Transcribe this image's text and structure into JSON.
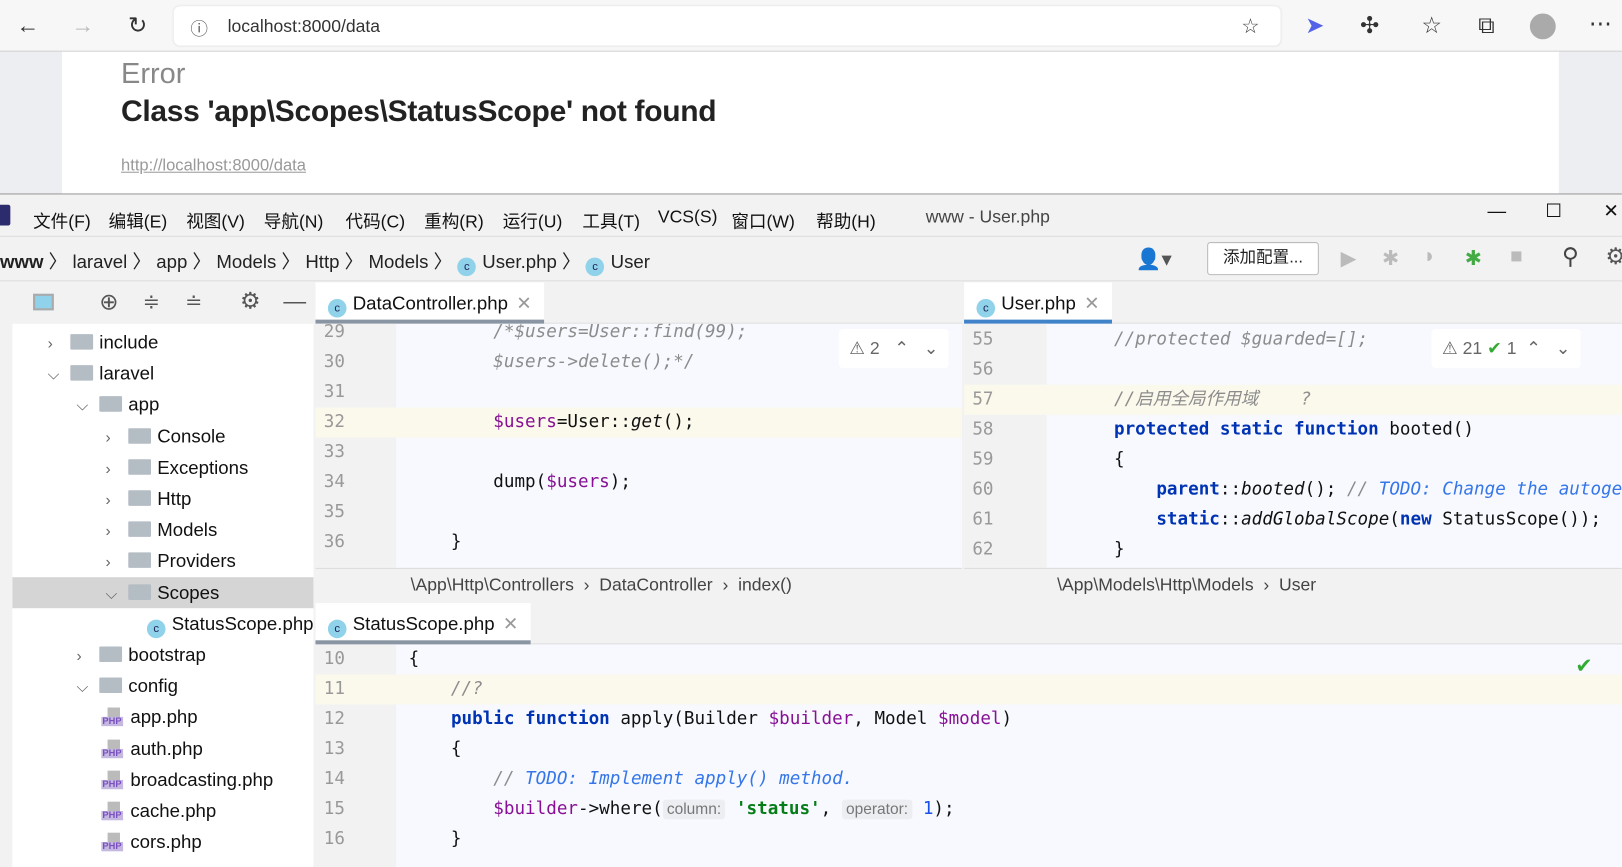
{
  "browser": {
    "url": "localhost:8000/data"
  },
  "page": {
    "error_label": "Error",
    "message": "Class 'app\\Scopes\\StatusScope' not found",
    "link": "http://localhost:8000/data"
  },
  "ide": {
    "menu": [
      "文件(F)",
      "编辑(E)",
      "视图(V)",
      "导航(N)",
      "代码(C)",
      "重构(R)",
      "运行(U)",
      "工具(T)",
      "VCS(S)",
      "窗口(W)",
      "帮助(H)"
    ],
    "window_title": "www - User.php",
    "breadcrumb": [
      "www",
      "laravel",
      "app",
      "Models",
      "Http",
      "Models",
      "User.php",
      "User"
    ],
    "add_config": "添加配置...",
    "tree": [
      {
        "label": "include",
        "depth": 0,
        "type": "folder",
        "expanded": false
      },
      {
        "label": "laravel",
        "depth": 0,
        "type": "folder",
        "expanded": true
      },
      {
        "label": "app",
        "depth": 1,
        "type": "folder",
        "expanded": true
      },
      {
        "label": "Console",
        "depth": 2,
        "type": "folder",
        "expanded": false
      },
      {
        "label": "Exceptions",
        "depth": 2,
        "type": "folder",
        "expanded": false
      },
      {
        "label": "Http",
        "depth": 2,
        "type": "folder",
        "expanded": false
      },
      {
        "label": "Models",
        "depth": 2,
        "type": "folder",
        "expanded": false
      },
      {
        "label": "Providers",
        "depth": 2,
        "type": "folder",
        "expanded": false
      },
      {
        "label": "Scopes",
        "depth": 2,
        "type": "folder",
        "expanded": true,
        "selected": true
      },
      {
        "label": "StatusScope.php",
        "depth": 3,
        "type": "class"
      },
      {
        "label": "bootstrap",
        "depth": 1,
        "type": "folder",
        "expanded": false
      },
      {
        "label": "config",
        "depth": 1,
        "type": "folder",
        "expanded": true
      },
      {
        "label": "app.php",
        "depth": 2,
        "type": "php"
      },
      {
        "label": "auth.php",
        "depth": 2,
        "type": "php"
      },
      {
        "label": "broadcasting.php",
        "depth": 2,
        "type": "php"
      },
      {
        "label": "cache.php",
        "depth": 2,
        "type": "php"
      },
      {
        "label": "cors.php",
        "depth": 2,
        "type": "php"
      }
    ],
    "editors": {
      "data_controller": {
        "tab": "DataController.php",
        "warnings": "2",
        "first_line": 29,
        "highlight": 32,
        "lines": [
          [
            [
              "        /*$users=User::find(99);",
              "cm"
            ]
          ],
          [
            [
              "        $users->delete();*/",
              "cm"
            ]
          ],
          [],
          [
            [
              "        ",
              ""
            ],
            [
              "$users",
              "var"
            ],
            [
              "=User::",
              ""
            ],
            [
              "get",
              "it"
            ],
            [
              "();",
              ""
            ]
          ],
          [],
          [
            [
              "        dump(",
              ""
            ],
            [
              "$users",
              "var"
            ],
            [
              ");",
              ""
            ]
          ],
          [],
          [
            [
              "    }",
              ""
            ]
          ]
        ],
        "crumbs": [
          "\\App\\Http\\Controllers",
          "DataController",
          "index()"
        ]
      },
      "user": {
        "tab": "User.php",
        "warnings": "21",
        "checks": "1",
        "first_line": 55,
        "highlight": 57,
        "lines": [
          [
            [
              "    //protected $guarded=[];",
              "cm"
            ]
          ],
          [],
          [
            [
              "    //启用全局作用域    ?",
              "cm"
            ]
          ],
          [
            [
              "    ",
              ""
            ],
            [
              "protected static function ",
              "kw"
            ],
            [
              "booted()",
              ""
            ]
          ],
          [
            [
              "    {",
              ""
            ]
          ],
          [
            [
              "        ",
              ""
            ],
            [
              "parent",
              "kw"
            ],
            [
              "::",
              ""
            ],
            [
              "booted",
              "it"
            ],
            [
              "(); ",
              ""
            ],
            [
              "// ",
              "cm"
            ],
            [
              "TODO: Change the autogen",
              "todo"
            ]
          ],
          [
            [
              "        ",
              ""
            ],
            [
              "static",
              "kw"
            ],
            [
              "::",
              ""
            ],
            [
              "addGlobalScope",
              "it"
            ],
            [
              "(",
              ""
            ],
            [
              "new ",
              "kw"
            ],
            [
              "StatusScope());",
              ""
            ]
          ],
          [
            [
              "    }",
              ""
            ]
          ]
        ],
        "crumbs": [
          "\\App\\Models\\Http\\Models",
          "User"
        ]
      },
      "status_scope": {
        "tab": "StatusScope.php",
        "first_line": 10,
        "highlight": 11,
        "lines": [
          [
            [
              "{",
              ""
            ]
          ],
          [
            [
              "    //?",
              "cm"
            ]
          ],
          [
            [
              "    ",
              ""
            ],
            [
              "public function ",
              "kw"
            ],
            [
              "apply(Builder ",
              ""
            ],
            [
              "$builder",
              "var"
            ],
            [
              ", Model ",
              ""
            ],
            [
              "$model",
              "var"
            ],
            [
              ")",
              ""
            ]
          ],
          [
            [
              "    {",
              ""
            ]
          ],
          [
            [
              "        ",
              ""
            ],
            [
              "// ",
              "cm"
            ],
            [
              "TODO: Implement apply() method.",
              "todo"
            ]
          ],
          [
            [
              "        ",
              ""
            ],
            [
              "$builder",
              "var"
            ],
            [
              "->where(",
              ""
            ],
            [
              "column:",
              "hint"
            ],
            [
              " ",
              ""
            ],
            [
              "'status'",
              "str"
            ],
            [
              ", ",
              ""
            ],
            [
              "operator:",
              "hint"
            ],
            [
              " ",
              ""
            ],
            [
              "1",
              "num"
            ],
            [
              ");",
              ""
            ]
          ],
          [
            [
              "    }",
              ""
            ]
          ]
        ]
      }
    }
  }
}
